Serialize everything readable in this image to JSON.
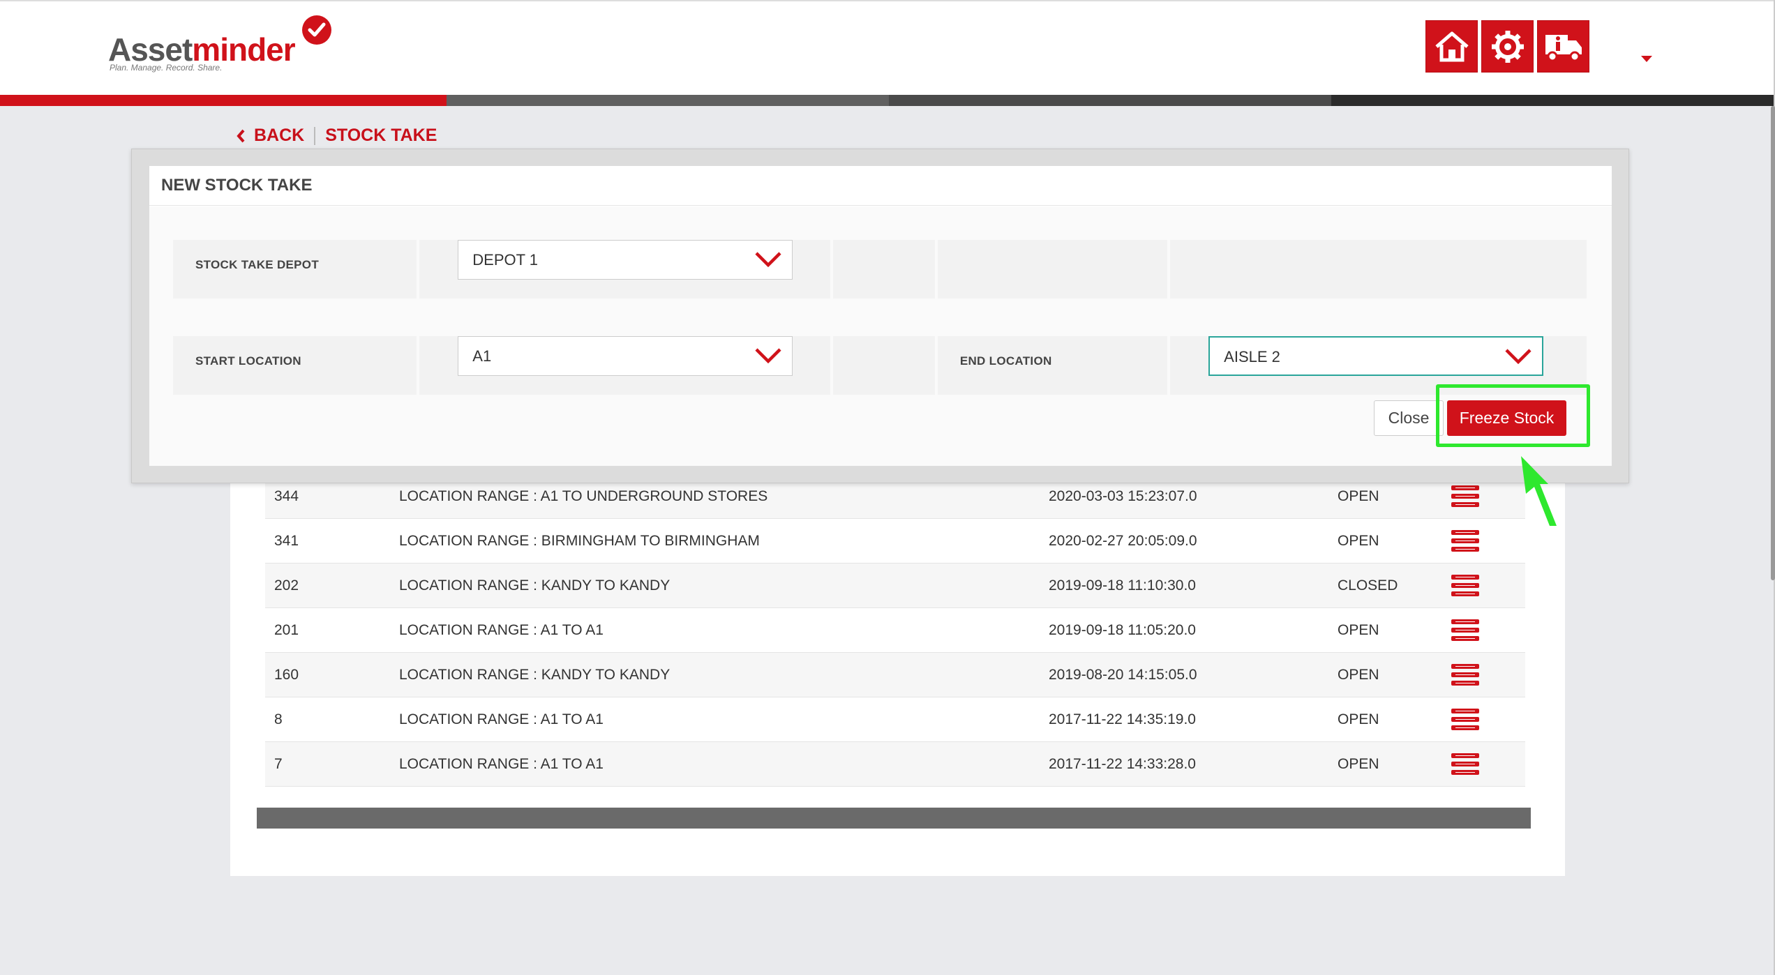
{
  "header": {
    "logo_part1": "Asset",
    "logo_part2": "minder",
    "logo_tagline": "Plan. Manage. Record. Share.",
    "icons": [
      "home-icon",
      "settings-icon",
      "truck-info-icon"
    ],
    "accent_color": "#d0121a"
  },
  "breadcrumb": {
    "back_label": "BACK",
    "current_label": "STOCK TAKE"
  },
  "modal": {
    "title": "NEW STOCK TAKE",
    "depot_label": "STOCK TAKE DEPOT",
    "depot_value": "DEPOT 1",
    "start_label": "START LOCATION",
    "start_value": "A1",
    "end_label": "END LOCATION",
    "end_value": "AISLE 2",
    "close_label": "Close",
    "freeze_label": "Freeze Stock"
  },
  "table": {
    "rows": [
      {
        "id": "344",
        "description": "LOCATION RANGE : A1 TO UNDERGROUND STORES",
        "date": "2020-03-03 15:23:07.0",
        "status": "OPEN"
      },
      {
        "id": "341",
        "description": "LOCATION RANGE : BIRMINGHAM TO BIRMINGHAM",
        "date": "2020-02-27 20:05:09.0",
        "status": "OPEN"
      },
      {
        "id": "202",
        "description": "LOCATION RANGE : KANDY TO KANDY",
        "date": "2019-09-18 11:10:30.0",
        "status": "CLOSED"
      },
      {
        "id": "201",
        "description": "LOCATION RANGE : A1 TO A1",
        "date": "2019-09-18 11:05:20.0",
        "status": "OPEN"
      },
      {
        "id": "160",
        "description": "LOCATION RANGE : KANDY TO KANDY",
        "date": "2019-08-20 14:15:05.0",
        "status": "OPEN"
      },
      {
        "id": "8",
        "description": "LOCATION RANGE : A1 TO A1",
        "date": "2017-11-22 14:35:19.0",
        "status": "OPEN"
      },
      {
        "id": "7",
        "description": "LOCATION RANGE : A1 TO A1",
        "date": "2017-11-22 14:33:28.0",
        "status": "OPEN"
      }
    ],
    "row_action_icon": "list-details-icon"
  },
  "annotation": {
    "highlight_color": "#2ee82e"
  }
}
